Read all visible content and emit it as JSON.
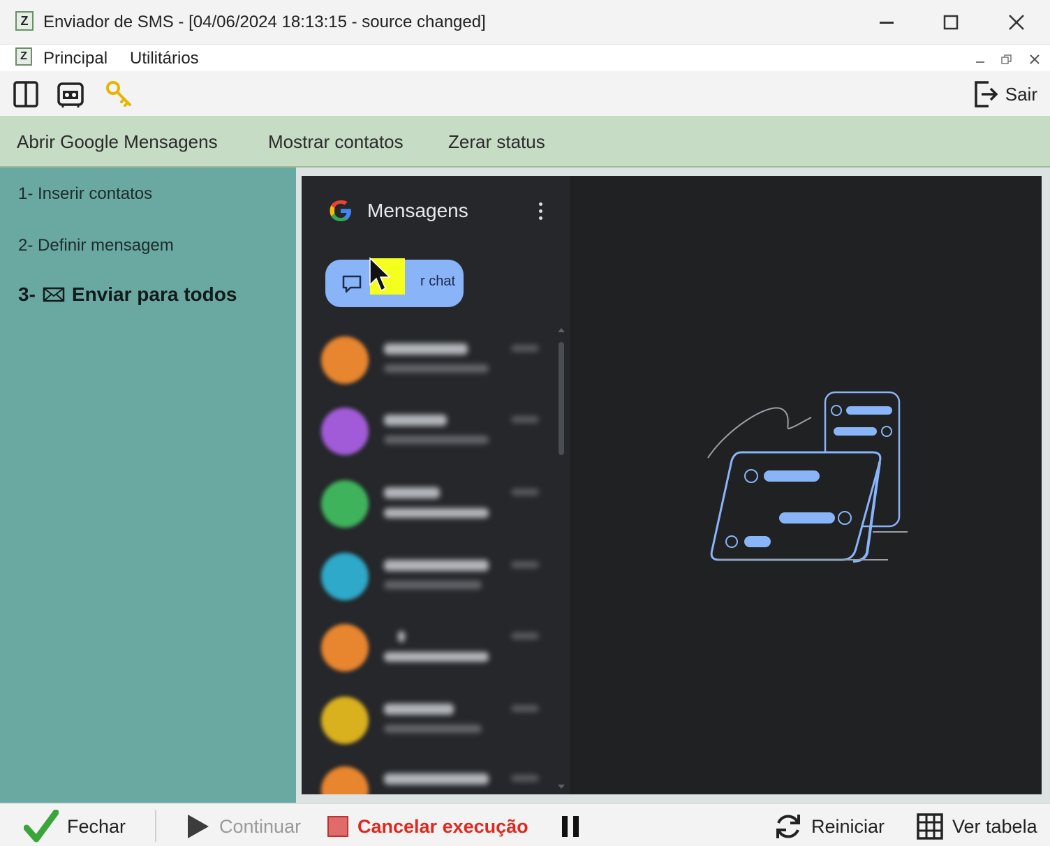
{
  "window": {
    "title": "Enviador de SMS - [04/06/2024 18:13:15 - source changed]",
    "app_icon_letter": "Z",
    "controls": {
      "minimize": "minimize-icon",
      "maximize": "maximize-icon",
      "close": "close-icon"
    }
  },
  "menu": {
    "items": [
      "Principal",
      "Utilitários"
    ]
  },
  "toolbar": {
    "icons": [
      "columns-icon",
      "scanner-icon",
      "key-icon"
    ],
    "exit_label": "Sair"
  },
  "actions": {
    "items": [
      "Abrir Google Mensagens",
      "Mostrar contatos",
      "Zerar status"
    ]
  },
  "sidebar": {
    "steps": [
      {
        "label": "1- Inserir contatos",
        "active": false
      },
      {
        "label": "2- Definir mensagem",
        "active": false
      },
      {
        "prefix": "3-",
        "label": "Enviar para todos",
        "icon": "envelope-icon",
        "active": true
      }
    ]
  },
  "messages_app": {
    "brand_title": "Mensagens",
    "new_chat_label": "r chat",
    "conversation_avatar_colors": [
      "#e8852f",
      "#a25bd8",
      "#3fb35c",
      "#2ea9c9",
      "#e8852f",
      "#d9b01e",
      "#e8852f"
    ]
  },
  "footer": {
    "close_label": "Fechar",
    "continue_label": "Continuar",
    "cancel_label": "Cancelar execução",
    "restart_label": "Reiniciar",
    "table_label": "Ver tabela"
  },
  "colors": {
    "sidebar_bg": "#6aa9a2",
    "action_bar_bg": "#c6dcc4",
    "accent_blue": "#8ab4f8",
    "cancel_red": "#e0281e",
    "check_green": "#3aa53a"
  }
}
